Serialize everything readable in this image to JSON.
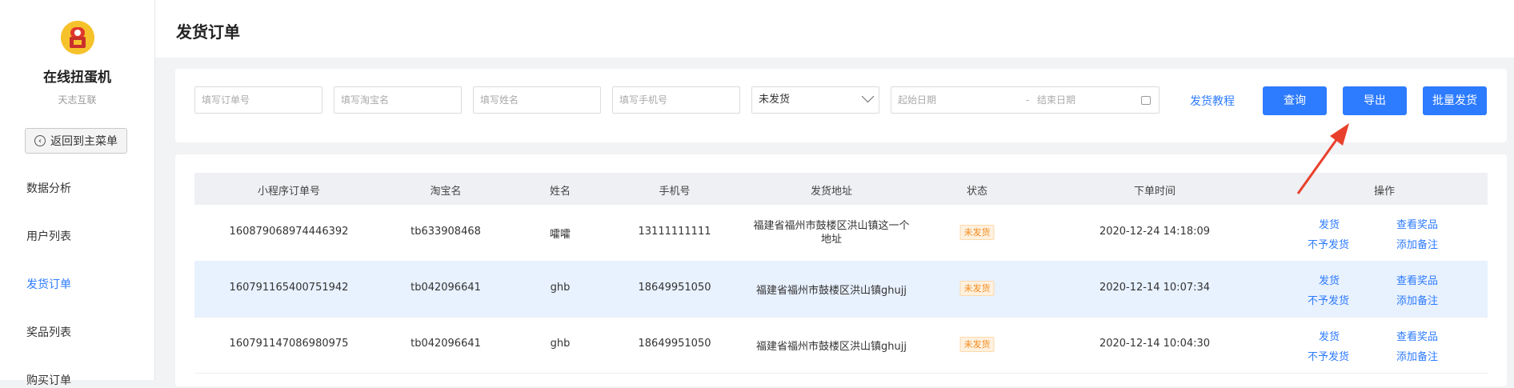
{
  "sidebar": {
    "app_name": "在线扭蛋机",
    "company": "天志互联",
    "back_button": "返回到主菜单",
    "items": [
      {
        "label": "数据分析"
      },
      {
        "label": "用户列表"
      },
      {
        "label": "发货订单"
      },
      {
        "label": "奖品列表"
      },
      {
        "label": "购买订单"
      }
    ],
    "active_index": 2
  },
  "page_title": "发货订单",
  "filters": {
    "order_no_placeholder": "填写订单号",
    "taobao_placeholder": "填写淘宝名",
    "name_placeholder": "填写姓名",
    "phone_placeholder": "填写手机号",
    "status_selected": "未发货",
    "start_date_placeholder": "起始日期",
    "range_separator": "-",
    "end_date_placeholder": "结束日期",
    "tutorial_link": "发货教程",
    "query_button": "查询",
    "export_button": "导出",
    "batch_ship_button": "批量发货"
  },
  "table": {
    "columns": [
      "小程序订单号",
      "淘宝名",
      "姓名",
      "手机号",
      "发货地址",
      "状态",
      "下单时间",
      "操作"
    ],
    "rows": [
      {
        "order_no": "160879068974446392",
        "taobao": "tb633908468",
        "name": "嚯嚯",
        "phone": "13111111111",
        "address": "福建省福州市鼓楼区洪山镇这一个地址",
        "status": "未发货",
        "time": "2020-12-24 14:18:09"
      },
      {
        "order_no": "160791165400751942",
        "taobao": "tb042096641",
        "name": "ghb",
        "phone": "18649951050",
        "address": "福建省福州市鼓楼区洪山镇ghujj",
        "status": "未发货",
        "time": "2020-12-14 10:07:34"
      },
      {
        "order_no": "160791147086980975",
        "taobao": "tb042096641",
        "name": "ghb",
        "phone": "18649951050",
        "address": "福建省福州市鼓楼区洪山镇ghujj",
        "status": "未发货",
        "time": "2020-12-14 10:04:30"
      }
    ],
    "actions": {
      "ship": "发货",
      "no_ship": "不予发货",
      "view_prize": "查看奖品",
      "add_note": "添加备注"
    }
  },
  "colors": {
    "accent": "#2d7bff",
    "annotation_arrow": "#e8402c",
    "status_badge": "#f08b1c"
  }
}
